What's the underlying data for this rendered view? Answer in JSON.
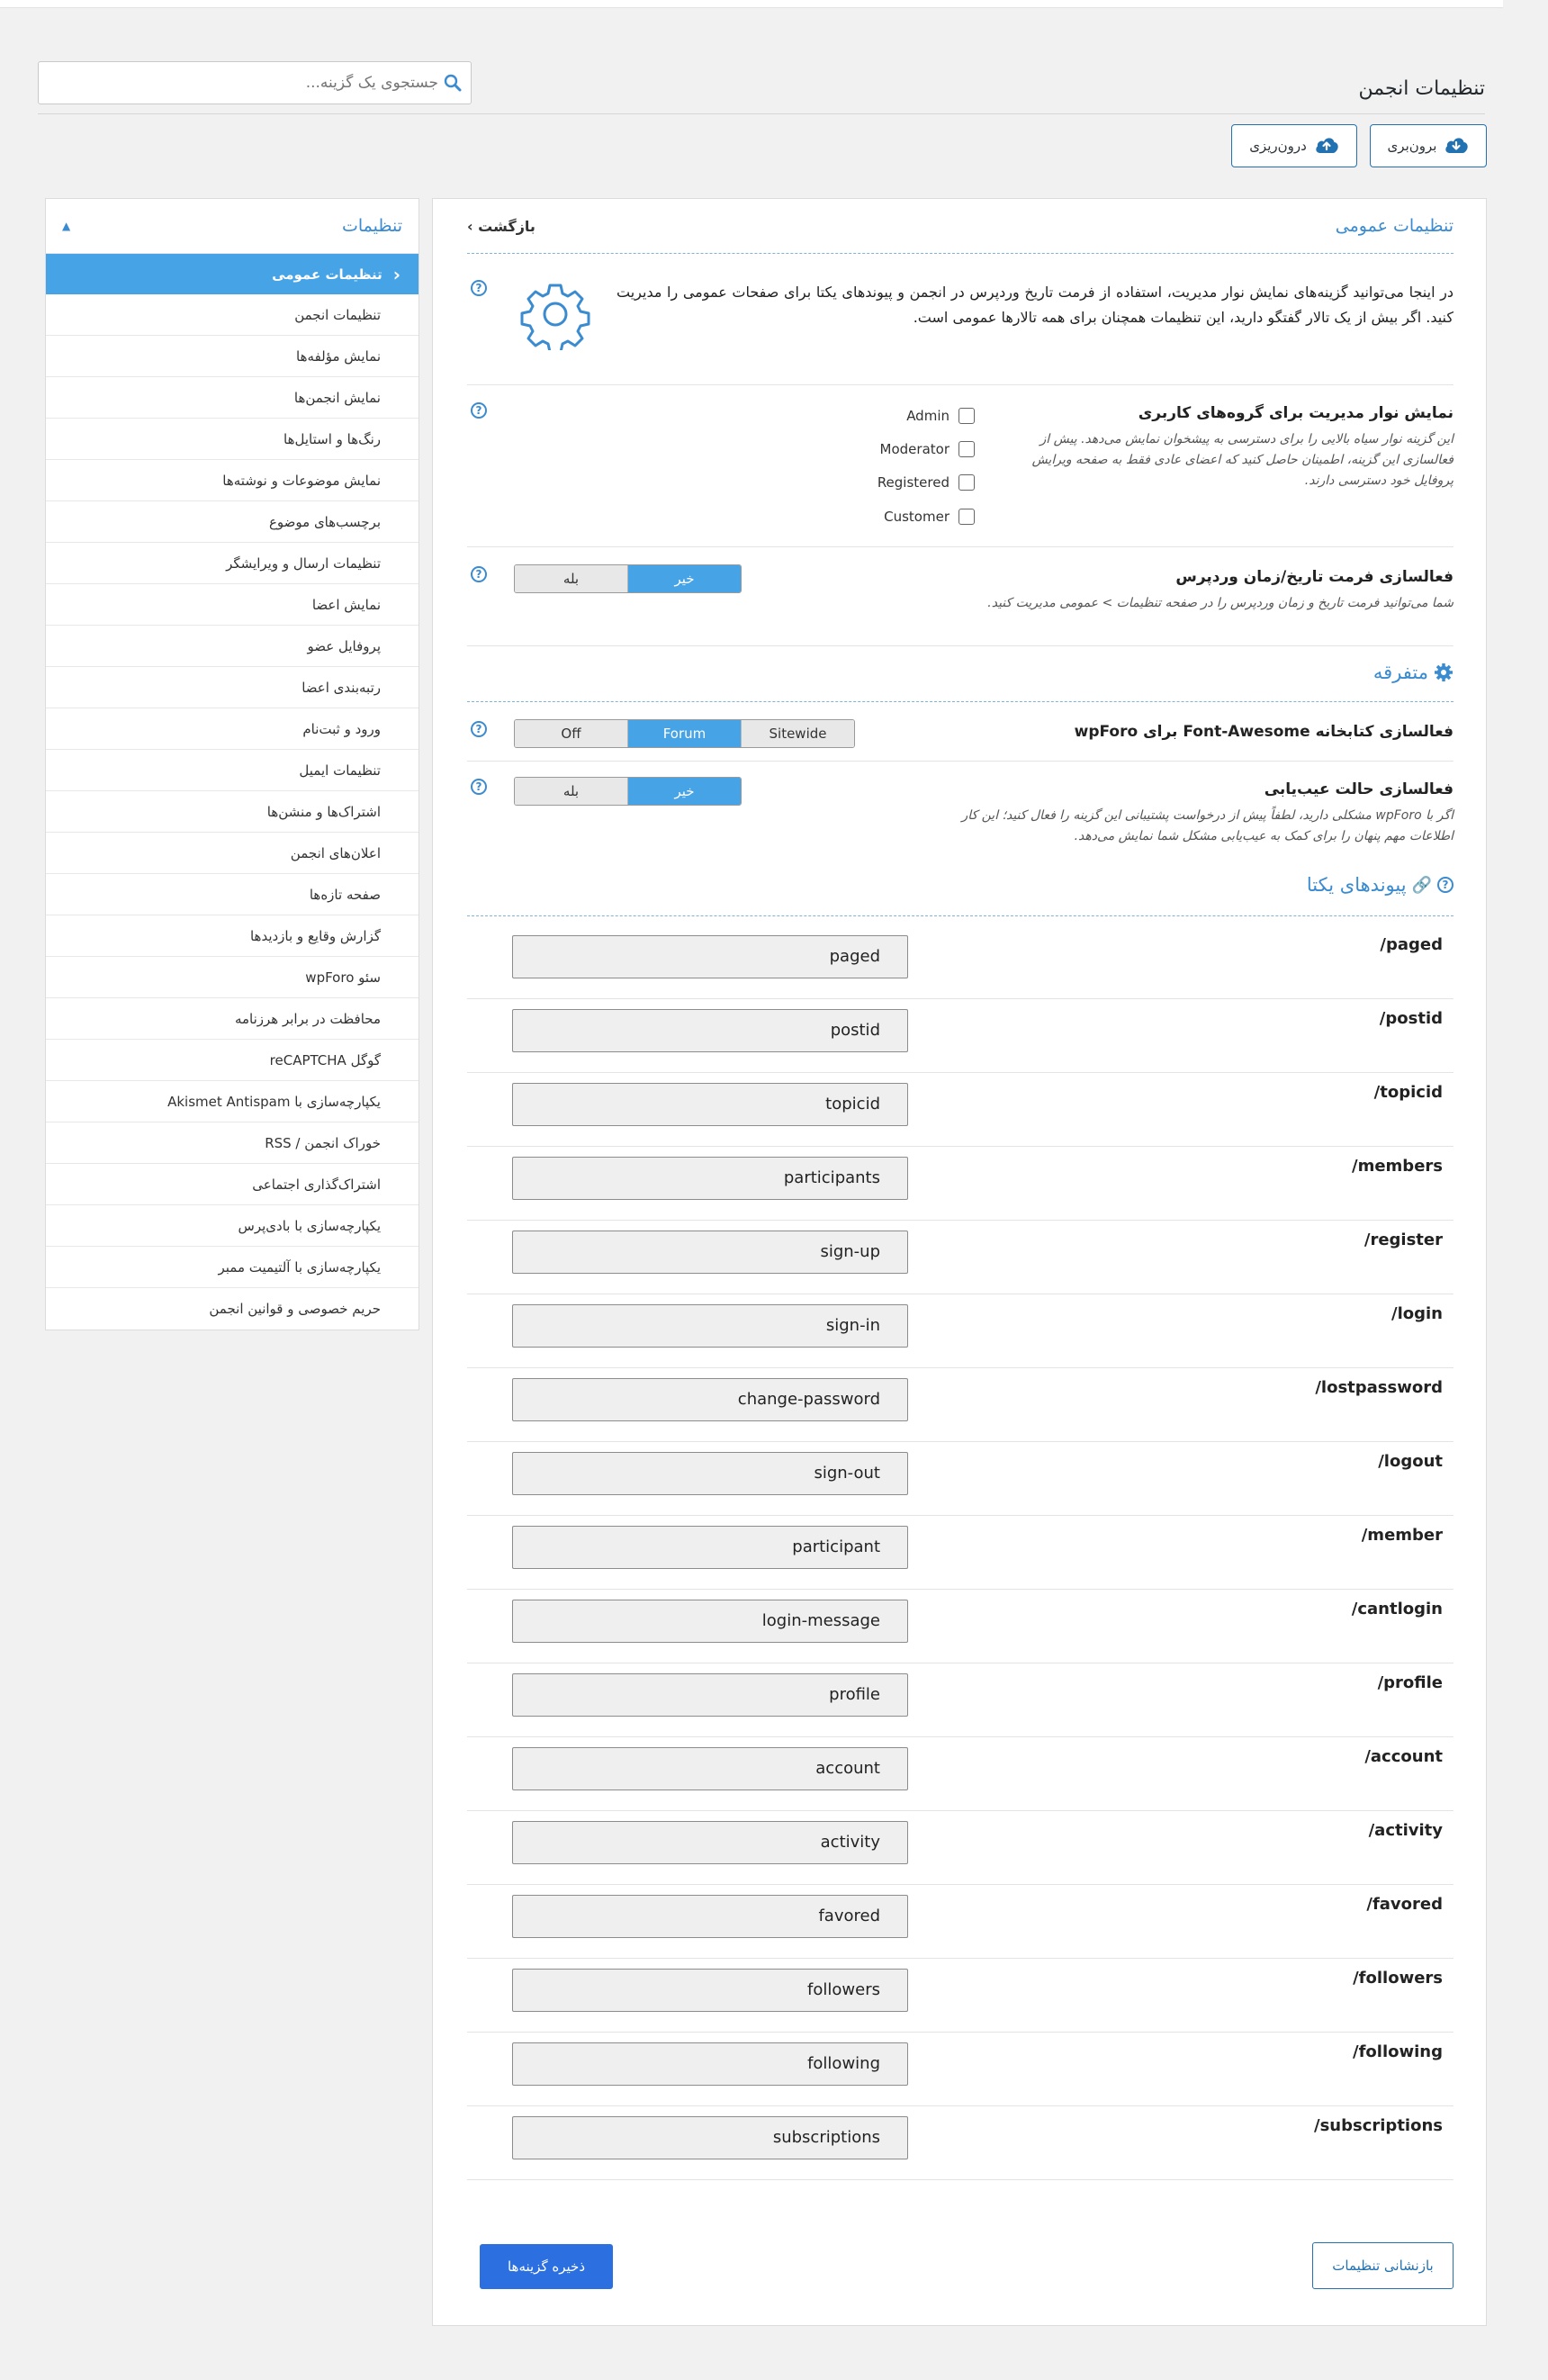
{
  "page": {
    "title": "تنظیمات انجمن"
  },
  "search": {
    "placeholder": "جستجوی یک گزینه..."
  },
  "toolbar": {
    "export_label": "برون‌بری",
    "import_label": "درون‌ریزی"
  },
  "sidebar": {
    "title": "تنظیمات",
    "items": [
      {
        "label": "تنظیمات عمومی",
        "active": true
      },
      {
        "label": "تنظیمات انجمن"
      },
      {
        "label": "نمایش مؤلفه‌ها"
      },
      {
        "label": "نمایش انجمن‌ها"
      },
      {
        "label": "رنگ‌ها و استایل‌ها"
      },
      {
        "label": "نمایش موضوعات و نوشته‌ها"
      },
      {
        "label": "برچسب‌های موضوع"
      },
      {
        "label": "تنظیمات ارسال و ویرایشگر"
      },
      {
        "label": "نمایش اعضا"
      },
      {
        "label": "پروفایل عضو"
      },
      {
        "label": "رتبه‌بندی اعضا"
      },
      {
        "label": "ورود و ثبت‌نام"
      },
      {
        "label": "تنظیمات ایمیل"
      },
      {
        "label": "اشتراک‌ها و منشن‌ها"
      },
      {
        "label": "اعلان‌های انجمن"
      },
      {
        "label": "صفحه تازه‌ها"
      },
      {
        "label": "گزارش وقایع و بازدیدها"
      },
      {
        "label": "سئو wpForo"
      },
      {
        "label": "محافظت در برابر هرزنامه"
      },
      {
        "label": "گوگل reCAPTCHA"
      },
      {
        "label": "یکپارچه‌سازی با Akismet Antispam"
      },
      {
        "label": "خوراک انجمن / RSS"
      },
      {
        "label": "اشتراک‌گذاری اجتماعی"
      },
      {
        "label": "یکپارچه‌سازی با بادی‌پرس"
      },
      {
        "label": "یکپارچه‌سازی با آلتیمیت ممبر"
      },
      {
        "label": "حریم خصوصی و قوانین انجمن"
      }
    ]
  },
  "panel": {
    "title": "تنظیمات عمومی",
    "back_label": "بازگشت",
    "intro": "در اینجا می‌توانید گزینه‌های نمایش نوار مدیریت، استفاده از فرمت تاریخ وردپرس در انجمن و پیوندهای یکتا برای صفحات عمومی را مدیریت کنید. اگر بیش از یک تالار گفتگو دارید، این تنظیمات همچنان برای همه تالارها عمومی است.",
    "admin_bar": {
      "title": "نمایش نوار مدیریت برای گروه‌های کاربری",
      "desc": "این گزینه نوار سیاه بالایی را برای دسترسی به پیشخوان نمایش می‌دهد. پیش از فعالسازی این گزینه، اطمینان حاصل کنید که اعضای عادی فقط به صفحه ویرایش پروفایل خود دسترسی دارند.",
      "groups": [
        "Admin",
        "Moderator",
        "Registered",
        "Customer"
      ]
    },
    "wp_date": {
      "title": "فعالسازی فرمت تاریخ/زمان وردپرس",
      "desc": "شما می‌توانید فرمت تاریخ و زمان وردپرس را در صفحه تنظیمات > عمومی مدیریت کنید.",
      "options": [
        "خیر",
        "بله"
      ],
      "selected": "خیر"
    },
    "misc": {
      "title": "متفرقه"
    },
    "font_awesome": {
      "title": "فعالسازی کتابخانه Font-Awesome برای wpForo",
      "options": [
        "Sitewide",
        "Forum",
        "Off"
      ],
      "selected": "Forum"
    },
    "debug": {
      "title": "فعالسازی حالت عیب‌یابی",
      "desc": "اگر با wpForo مشکلی دارید، لطفاً پیش از درخواست پشتیبانی این گزینه را فعال کنید؛ این کار اطلاعات مهم پنهان را برای کمک به عیب‌یابی مشکل شما نمایش می‌دهد.",
      "options": [
        "خیر",
        "بله"
      ],
      "selected": "خیر"
    },
    "permalinks": {
      "title": "پیوندهای یکتا",
      "rows": [
        {
          "key": "/paged",
          "value": "paged"
        },
        {
          "key": "/postid",
          "value": "postid"
        },
        {
          "key": "/topicid",
          "value": "topicid"
        },
        {
          "key": "/members",
          "value": "participants"
        },
        {
          "key": "/register",
          "value": "sign-up"
        },
        {
          "key": "/login",
          "value": "sign-in"
        },
        {
          "key": "/lostpassword",
          "value": "change-password"
        },
        {
          "key": "/logout",
          "value": "sign-out"
        },
        {
          "key": "/member",
          "value": "participant"
        },
        {
          "key": "/cantlogin",
          "value": "login-message"
        },
        {
          "key": "/profile",
          "value": "profile"
        },
        {
          "key": "/account",
          "value": "account"
        },
        {
          "key": "/activity",
          "value": "activity"
        },
        {
          "key": "/favored",
          "value": "favored"
        },
        {
          "key": "/followers",
          "value": "followers"
        },
        {
          "key": "/following",
          "value": "following"
        },
        {
          "key": "/subscriptions",
          "value": "subscriptions"
        }
      ]
    },
    "reset_label": "بازنشانی تنظیمات",
    "save_label": "ذخیره گزینه‌ها"
  },
  "colors": {
    "accent": "#46a3e6",
    "link": "#3a8bd0",
    "primary_button": "#2b6fe0"
  }
}
